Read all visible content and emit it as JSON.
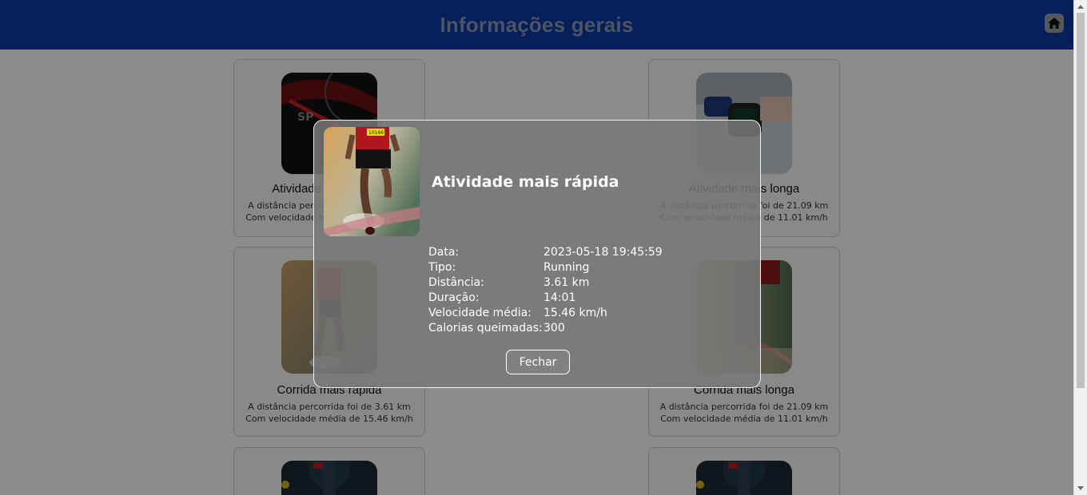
{
  "header": {
    "title": "Informações gerais",
    "home_icon": "home-icon"
  },
  "cards": [
    {
      "title": "Atividade mais rápida",
      "line1": "A distância percorrida foi de 3.61 km",
      "line2": "Com velocidade média de 15.46 km/h",
      "image": "speedometer-image"
    },
    {
      "title": "Atividade mais longa",
      "line1": "A distância percorrida foi de 21.09 km",
      "line2": "Com velocidade média de 11.01 km/h",
      "image": "smartwatch-image"
    },
    {
      "title": "Corrida mais rápida",
      "line1": "A distância percorrida foi de 3.61 km",
      "line2": "Com velocidade média de 15.46 km/h",
      "image": "runner-image"
    },
    {
      "title": "Corrida mais longa",
      "line1": "A distância percorrida foi de 21.09 km",
      "line2": "Com velocidade média de 11.01 km/h",
      "image": "runner-image"
    },
    {
      "title": "",
      "line1": "",
      "line2": "",
      "image": "cyclist-image"
    },
    {
      "title": "",
      "line1": "",
      "line2": "",
      "image": "cyclist-image"
    }
  ],
  "modal": {
    "title": "Atividade mais rápida",
    "image": "runner-image",
    "details": [
      {
        "label": "Data:",
        "value": "2023-05-18 19:45:59"
      },
      {
        "label": "Tipo:",
        "value": "Running"
      },
      {
        "label": "Distância:",
        "value": "3.61 km"
      },
      {
        "label": "Duração:",
        "value": "14:01"
      },
      {
        "label": "Velocidade média:",
        "value": "15.46 km/h"
      },
      {
        "label": "Calorias queimadas:",
        "value": "300"
      }
    ],
    "close_label": "Fechar"
  },
  "colors": {
    "header_bg": "#0a3aa6",
    "overlay": "rgba(0,0,0,0.45)",
    "modal_bg": "#787878"
  }
}
